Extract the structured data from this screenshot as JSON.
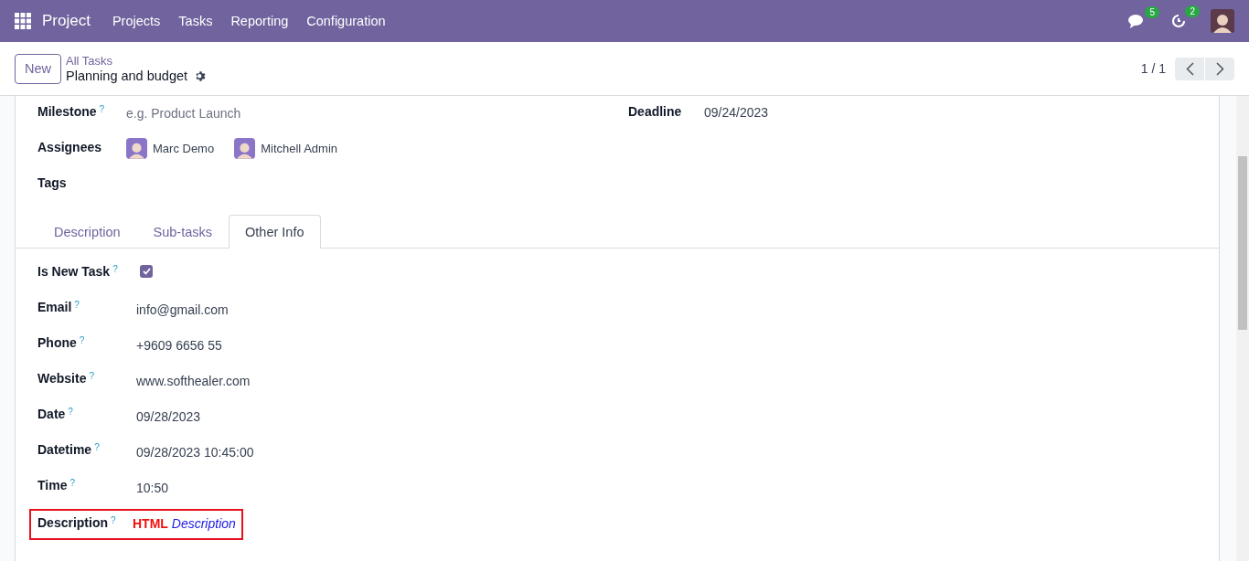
{
  "navbar": {
    "app": "Project",
    "menu": [
      "Projects",
      "Tasks",
      "Reporting",
      "Configuration"
    ],
    "messages_badge": "5",
    "activities_badge": "2"
  },
  "control_panel": {
    "new_button": "New",
    "breadcrumb": "All Tasks",
    "title": "Planning and budget",
    "pager": "1 / 1"
  },
  "top_fields": {
    "left": [
      {
        "kind": "placeholder",
        "label": "Milestone",
        "help": "?",
        "placeholder": "e.g. Product Launch"
      },
      {
        "kind": "people",
        "label": "Assignees",
        "people": [
          "Marc Demo",
          "Mitchell Admin"
        ]
      },
      {
        "kind": "empty",
        "label": "Tags"
      }
    ],
    "right": [
      {
        "kind": "text",
        "label": "Deadline",
        "value": "09/24/2023"
      }
    ]
  },
  "tabs": [
    {
      "label": "Description",
      "selected": false
    },
    {
      "label": "Sub-tasks",
      "selected": false
    },
    {
      "label": "Other Info",
      "selected": true
    }
  ],
  "fields": [
    {
      "kind": "checkbox",
      "label": "Is New Task",
      "help": "?",
      "checked": true
    },
    {
      "kind": "text",
      "label": "Email",
      "help": "?",
      "value": "info@gmail.com"
    },
    {
      "kind": "text",
      "label": "Phone",
      "help": "?",
      "value": "+9609 6656 55"
    },
    {
      "kind": "text",
      "label": "Website",
      "help": "?",
      "value": "www.softhealer.com"
    },
    {
      "kind": "text",
      "label": "Date",
      "help": "?",
      "value": "09/28/2023"
    },
    {
      "kind": "text",
      "label": "Datetime",
      "help": "?",
      "value": "09/28/2023 10:45:00"
    },
    {
      "kind": "text",
      "label": "Time",
      "help": "?",
      "value": "10:50"
    },
    {
      "kind": "html",
      "label": "Description",
      "help": "?",
      "value": "**HTML** *Description*",
      "highlighted": true
    }
  ]
}
